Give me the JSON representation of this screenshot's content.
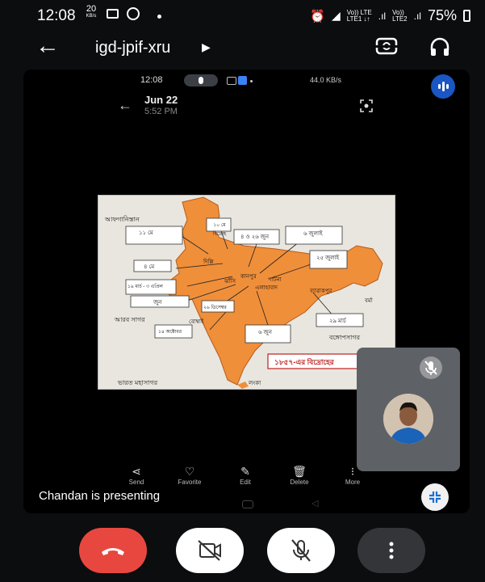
{
  "status_bar": {
    "time": "12:08",
    "net_speed_value": "20",
    "net_speed_unit": "KB/s",
    "sim1": "Vo)) LTE",
    "sim1_sub": "LTE1 ↓↑",
    "sim2": "Vo))",
    "sim2_sub": "LTE2",
    "battery": "75%"
  },
  "appbar": {
    "meeting_code": "igd-jpif-xru"
  },
  "presented_screen": {
    "status_time": "12:08",
    "status_right": "44.0 KB/s",
    "date": "Jun 22",
    "time": "5:52 PM",
    "toolbar": [
      {
        "label": "Send",
        "icon": "share-icon"
      },
      {
        "label": "Favorite",
        "icon": "heart-icon"
      },
      {
        "label": "Edit",
        "icon": "edit-icon"
      },
      {
        "label": "Delete",
        "icon": "delete-icon"
      },
      {
        "label": "More",
        "icon": "more-icon"
      }
    ],
    "map": {
      "top_left": "আফগানিস্তান",
      "label_1": "১১ মে",
      "label_2": "১০ মে বিদ্রোহ",
      "label_3": "৪ ও ২৬ জুন",
      "label_4": "৬ জুলাই",
      "label_5": "২৫ জুলাই",
      "label_6": "৪ মে",
      "label_7": "১৯ মার্চ - ৩ এপ্রিল",
      "label_8": "জুন",
      "label_9": "২৬ ডিসেম্বর",
      "label_10": "১৪ অক্টোবর",
      "label_11": "৬ জুন",
      "label_12": "২৯ মার্চ",
      "city_1": "দিল্লি",
      "city_2": "কানপুর",
      "city_3": "পাটনা",
      "city_4": "এলাহাবাদ",
      "city_5": "ব্যারাকপুর",
      "city_6": "ঝাঁসি",
      "city_7": "বোম্বাই",
      "city_8": "বর্মা",
      "sea_1": "আরব সাগর",
      "sea_2": "বঙ্গোপসাগর",
      "sea_3": "ভারত মহাসাগর",
      "lanka": "লংকা",
      "banner": "১৮৫৭-এর বিদ্রোহের"
    }
  },
  "presenting_label": "Chandan is presenting"
}
